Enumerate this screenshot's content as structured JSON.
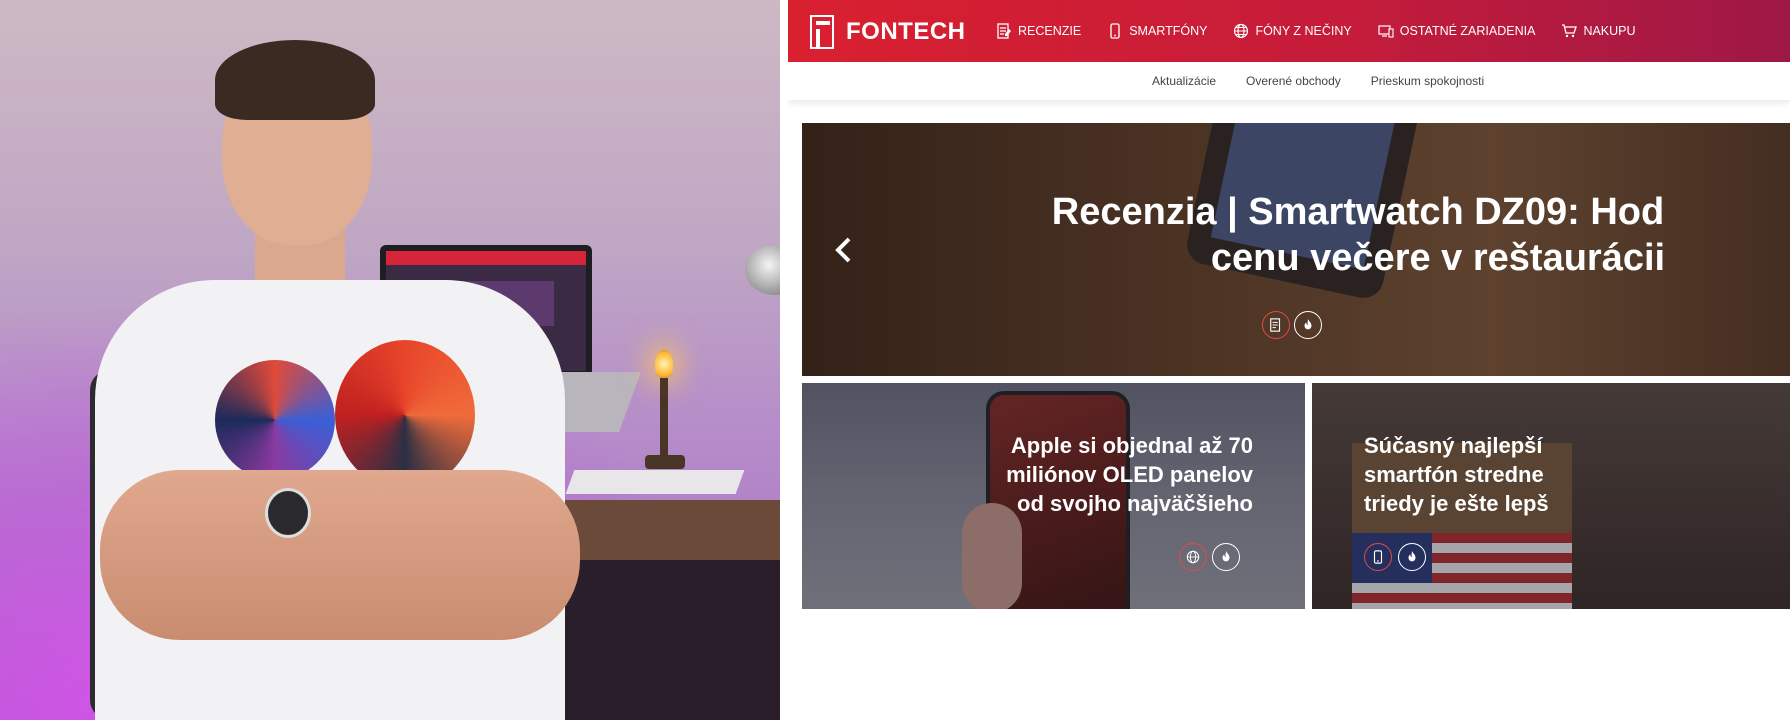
{
  "site": {
    "logo_text": "FONTECH",
    "nav": [
      {
        "label": "RECENZIE",
        "icon": "review-icon"
      },
      {
        "label": "SMARTFÓNY",
        "icon": "smartphone-icon"
      },
      {
        "label": "FÓNY Z NEČINY",
        "icon": "globe-icon"
      },
      {
        "label": "OSTATNÉ ZARIADENIA",
        "icon": "devices-icon"
      },
      {
        "label": "NAKUPU",
        "icon": "cart-icon"
      }
    ],
    "subnav": [
      "Aktualizácie",
      "Overené obchody",
      "Prieskum spokojnosti"
    ],
    "hero": {
      "title_line1": "Recenzia | Smartwatch DZ09: Hod",
      "title_line2": "cenu večere v reštaurácii",
      "badges": [
        "review-icon",
        "fire-icon"
      ]
    },
    "tiles": [
      {
        "lines": [
          "Apple si objednal až 70",
          "miliónov OLED panelov",
          "od svojho najväčšieho"
        ],
        "badges": [
          "globe-icon",
          "fire-icon"
        ]
      },
      {
        "lines": [
          "Súčasný najlepší",
          "smartfón stredne",
          "triedy je ešte lepš"
        ],
        "badges": [
          "smartphone-icon",
          "fire-icon"
        ]
      }
    ]
  },
  "colors": {
    "brand_red": "#d9202f",
    "brand_dark": "#9e1846",
    "badge_red": "#e04a4a"
  }
}
